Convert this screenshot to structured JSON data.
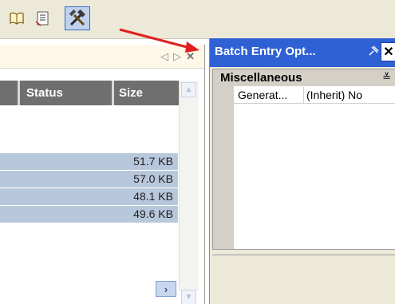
{
  "left": {
    "nav_prev": "◁",
    "nav_next": "▷",
    "nav_close": "✕",
    "columns": [
      "Status",
      "Size"
    ],
    "rows": [
      {
        "size": "51.7 KB"
      },
      {
        "size": "57.0 KB"
      },
      {
        "size": "48.1 KB"
      },
      {
        "size": "49.6 KB"
      }
    ]
  },
  "right": {
    "title": "Batch Entry Opt...",
    "pin": "⊰",
    "close": "✕",
    "category": "Miscellaneous",
    "collapse": "≚",
    "property_name": "Generat...",
    "property_value": "(Inherit) No"
  },
  "icons": [
    "book-icon",
    "properties-icon",
    "tools-icon"
  ],
  "colors": {
    "accent": "#2f61d5",
    "selection": "#b8c8dc",
    "arrow": "#e02020"
  }
}
